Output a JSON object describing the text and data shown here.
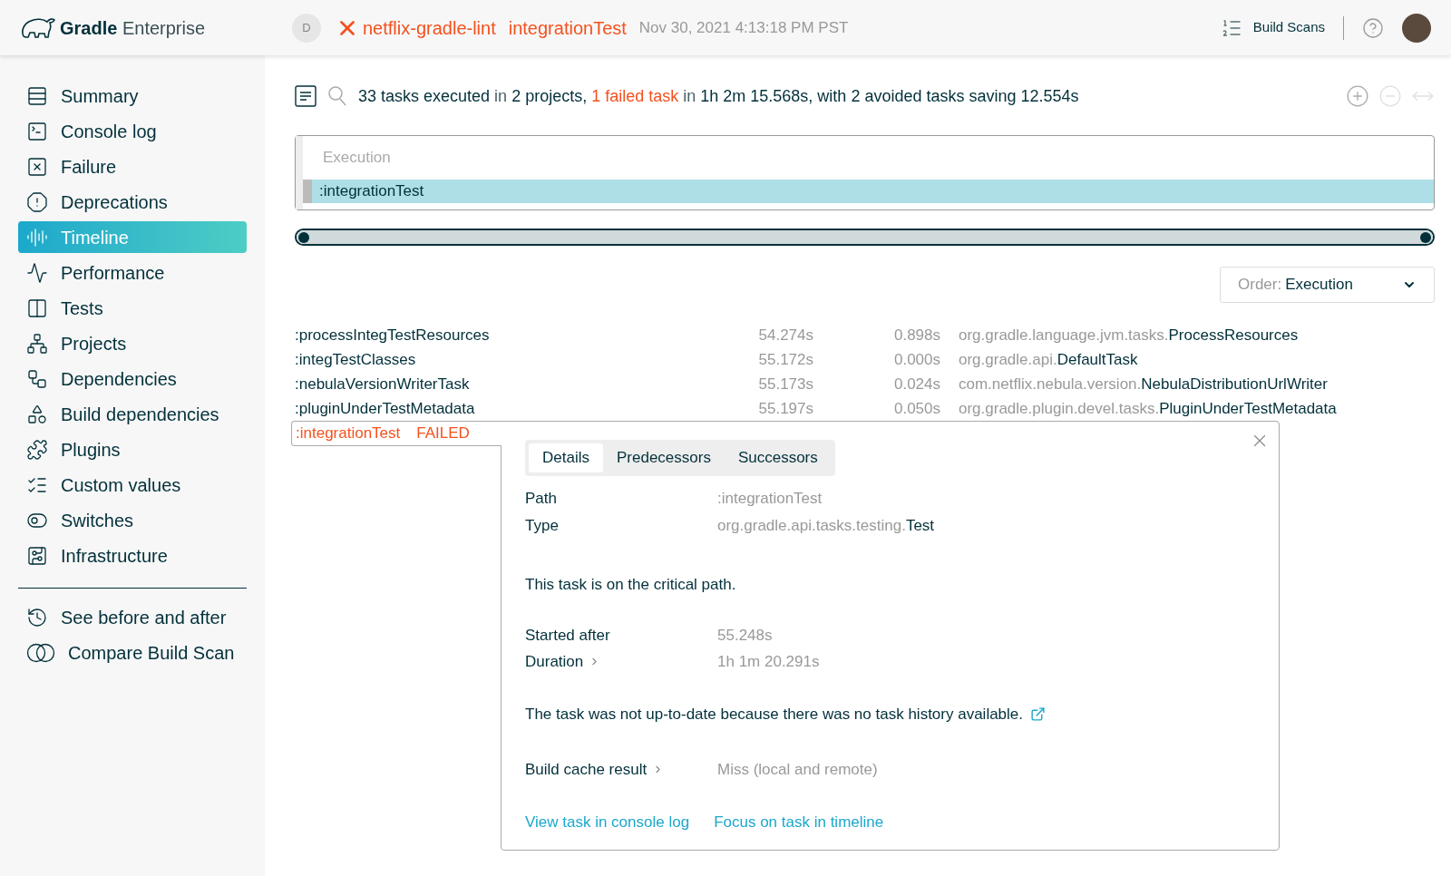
{
  "header": {
    "logo_bold": "Gradle",
    "logo_light": "Enterprise",
    "user_initial": "D",
    "build_failed": true,
    "project": "netflix-gradle-lint",
    "task": "integrationTest",
    "date": "Nov 30, 2021 4:13:18 PM PST",
    "build_scans": "Build Scans"
  },
  "sidebar": {
    "items": [
      {
        "label": "Summary",
        "selected": false
      },
      {
        "label": "Console log",
        "selected": false
      },
      {
        "label": "Failure",
        "selected": false
      },
      {
        "label": "Deprecations",
        "selected": false
      },
      {
        "label": "Timeline",
        "selected": true
      },
      {
        "label": "Performance",
        "selected": false
      },
      {
        "label": "Tests",
        "selected": false
      },
      {
        "label": "Projects",
        "selected": false
      },
      {
        "label": "Dependencies",
        "selected": false
      },
      {
        "label": "Build dependencies",
        "selected": false
      },
      {
        "label": "Plugins",
        "selected": false
      },
      {
        "label": "Custom values",
        "selected": false
      },
      {
        "label": "Switches",
        "selected": false
      },
      {
        "label": "Infrastructure",
        "selected": false
      }
    ],
    "extra_items": [
      {
        "label": "See before and after"
      },
      {
        "label": "Compare Build Scan"
      }
    ]
  },
  "summary": [
    {
      "text": "33 tasks",
      "kind": "strong"
    },
    {
      "text": " executed ",
      "kind": "plain"
    },
    {
      "text": "in",
      "kind": "muted"
    },
    {
      "text": " 2 projects",
      "kind": "strong"
    },
    {
      "text": ", ",
      "kind": "plain"
    },
    {
      "text": "1 failed task",
      "kind": "failed"
    },
    {
      "text": " in ",
      "kind": "muted"
    },
    {
      "text": "1h 2m 15.568s",
      "kind": "strong"
    },
    {
      "text": ", with ",
      "kind": "plain"
    },
    {
      "text": "2 avoided tasks",
      "kind": "strong"
    },
    {
      "text": " saving ",
      "kind": "plain"
    },
    {
      "text": "12.554s",
      "kind": "strong"
    }
  ],
  "zoom_tools": [
    {
      "kind": "zoom-in",
      "disabled": false
    },
    {
      "kind": "zoom-out",
      "disabled": true
    },
    {
      "kind": "fit",
      "disabled": true
    }
  ],
  "timeline": {
    "lane": "Execution",
    "bar": ":integrationTest",
    "range": {
      "level": 1
    }
  },
  "order": {
    "label": "Order:",
    "value": "Execution"
  },
  "tasks": [
    {
      "name": ":processIntegTestResources",
      "start": "54.274s",
      "duration": "0.898s",
      "type_package": "org.gradle.language.jvm.tasks.",
      "type_class": "ProcessResources"
    },
    {
      "name": ":integTestClasses",
      "start": "55.172s",
      "duration": "0.000s",
      "type_package": "org.gradle.api.",
      "type_class": "DefaultTask"
    },
    {
      "name": ":nebulaVersionWriterTask",
      "start": "55.173s",
      "duration": "0.024s",
      "type_package": "com.netflix.nebula.version.",
      "type_class": "NebulaDistributionUrlWriter"
    },
    {
      "name": ":pluginUnderTestMetadata",
      "start": "55.197s",
      "duration": "0.050s",
      "type_package": "org.gradle.plugin.devel.tasks.",
      "type_class": "PluginUnderTestMetadata"
    }
  ],
  "failed_task": {
    "name": ":integrationTest",
    "status": "FAILED"
  },
  "details": {
    "tabs": [
      {
        "label": "Details",
        "selected": true
      },
      {
        "label": "Predecessors",
        "selected": false
      },
      {
        "label": "Successors",
        "selected": false
      }
    ],
    "path_label": "Path",
    "path": ":integrationTest",
    "type_label": "Type",
    "type_package": "org.gradle.api.tasks.testing.",
    "type_class": "Test",
    "critical": "This task is on the critical path.",
    "started_label": "Started after",
    "started": "55.248s",
    "duration_label": "Duration",
    "duration": "1h 1m 20.291s",
    "reason": "The task was not up-to-date because there was no task history available.",
    "cache_label": "Build cache result",
    "cache": "Miss (local and remote)",
    "links": [
      "View task in console log",
      "Focus on task in timeline"
    ]
  }
}
